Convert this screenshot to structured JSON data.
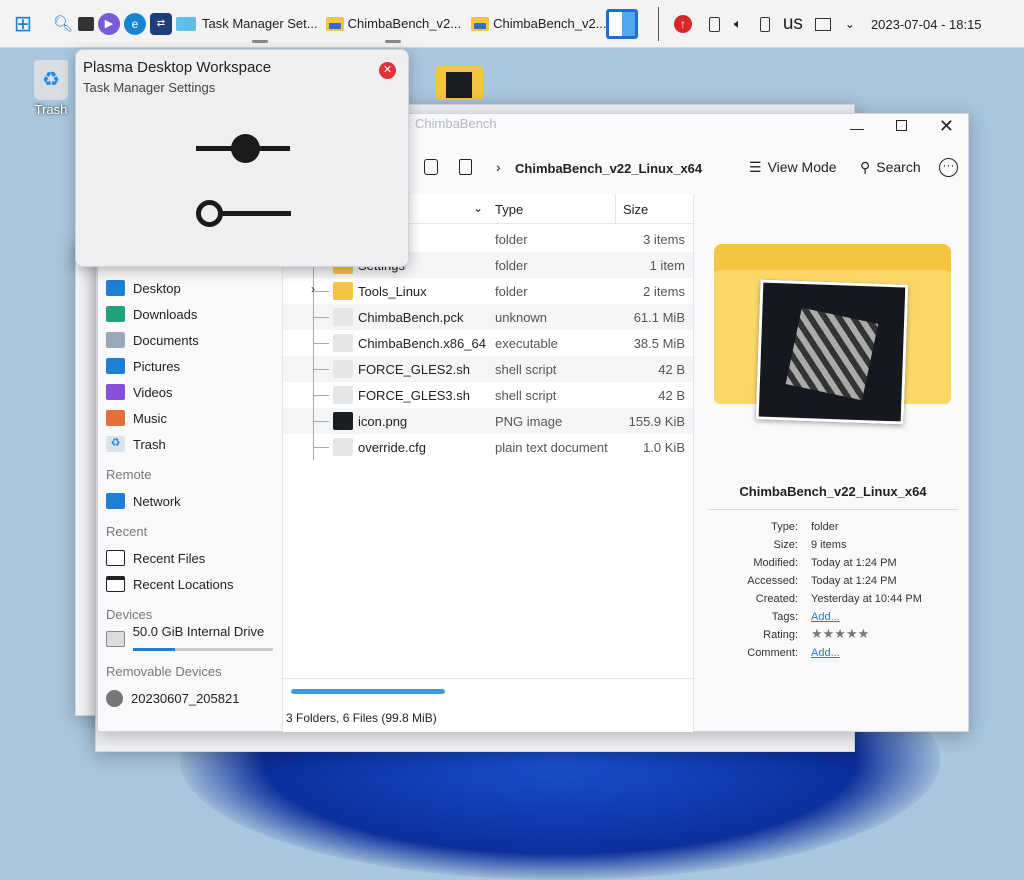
{
  "taskbar": {
    "tasks": [
      {
        "label": "Task Manager Set..."
      },
      {
        "label": "ChimbaBench_v2..."
      },
      {
        "label": "ChimbaBench_v2..."
      }
    ],
    "tray": {
      "keyboard_layout": "us",
      "clock": "2023-07-04 - 18:15"
    }
  },
  "desktop": {
    "trash_label": "Trash"
  },
  "popup": {
    "title": "Plasma Desktop Workspace",
    "subtitle": "Task Manager Settings"
  },
  "back_window": {
    "title": "ChimbaBench"
  },
  "dolphin": {
    "breadcrumb": "ChimbaBench_v22_Linux_x64",
    "view_mode": "View Mode",
    "search": "Search",
    "sidebar": {
      "places": [
        "Desktop",
        "Downloads",
        "Documents",
        "Pictures",
        "Videos",
        "Music",
        "Trash"
      ],
      "remote_header": "Remote",
      "remote": [
        "Network"
      ],
      "recent_header": "Recent",
      "recent": [
        "Recent Files",
        "Recent Locations"
      ],
      "devices_header": "Devices",
      "devices": [
        {
          "label": "50.0 GiB Internal Drive ...",
          "usage": 0.3
        }
      ],
      "removable_header": "Removable Devices",
      "removable": [
        "20230607_205821"
      ]
    },
    "columns": {
      "type": "Type",
      "size": "Size"
    },
    "files": [
      {
        "name": "",
        "type": "folder",
        "size": "3 items",
        "kind": "folder"
      },
      {
        "name": "Settings",
        "type": "folder",
        "size": "1 item",
        "kind": "folder"
      },
      {
        "name": "Tools_Linux",
        "type": "folder",
        "size": "2 items",
        "kind": "folder"
      },
      {
        "name": "ChimbaBench.pck",
        "type": "unknown",
        "size": "61.1 MiB",
        "kind": "file"
      },
      {
        "name": "ChimbaBench.x86_64",
        "type": "executable",
        "size": "38.5 MiB",
        "kind": "exec"
      },
      {
        "name": "FORCE_GLES2.sh",
        "type": "shell script",
        "size": "42 B",
        "kind": "script"
      },
      {
        "name": "FORCE_GLES3.sh",
        "type": "shell script",
        "size": "42 B",
        "kind": "script"
      },
      {
        "name": "icon.png",
        "type": "PNG image",
        "size": "155.9 KiB",
        "kind": "image"
      },
      {
        "name": "override.cfg",
        "type": "plain text document",
        "size": "1.0 KiB",
        "kind": "file"
      }
    ],
    "status": "3 Folders, 6 Files (99.8 MiB)",
    "progress": 0.55,
    "info": {
      "name": "ChimbaBench_v22_Linux_x64",
      "fields": [
        {
          "label": "Type:",
          "value": "folder"
        },
        {
          "label": "Size:",
          "value": "9 items"
        },
        {
          "label": "Modified:",
          "value": "Today at 1:24 PM"
        },
        {
          "label": "Accessed:",
          "value": "Today at 1:24 PM"
        },
        {
          "label": "Created:",
          "value": "Yesterday at 10:44 PM"
        },
        {
          "label": "Tags:",
          "value": "Add..."
        },
        {
          "label": "Rating:",
          "value": "★★★★★"
        },
        {
          "label": "Comment:",
          "value": "Add..."
        }
      ]
    }
  }
}
